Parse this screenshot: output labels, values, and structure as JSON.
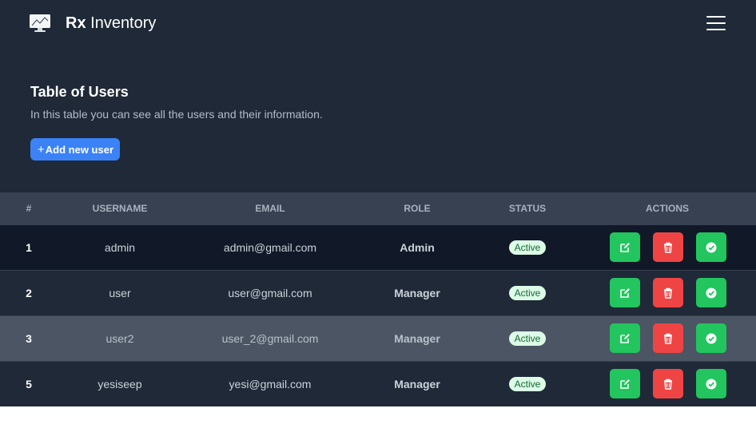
{
  "navbar": {
    "brand_bold": "Rx",
    "brand_rest": " Inventory",
    "logo_icon": "desktop-monitor-icon",
    "menu_icon": "hamburger-menu-icon"
  },
  "header": {
    "title": "Table of Users",
    "subtitle": "In this table you can see all the users and their information.",
    "add_button_icon": "+",
    "add_button_label": "Add new user"
  },
  "table": {
    "columns": [
      "#",
      "USERNAME",
      "EMAIL",
      "ROLE",
      "STATUS",
      "ACTIONS"
    ],
    "rows": [
      {
        "id": "1",
        "username": "admin",
        "email": "admin@gmail.com",
        "role": "Admin",
        "status": "Active"
      },
      {
        "id": "2",
        "username": "user",
        "email": "user@gmail.com",
        "role": "Manager",
        "status": "Active"
      },
      {
        "id": "3",
        "username": "user2",
        "email": "user_2@gmail.com",
        "role": "Manager",
        "status": "Active"
      },
      {
        "id": "5",
        "username": "yesiseep",
        "email": "yesi@gmail.com",
        "role": "Manager",
        "status": "Active"
      }
    ],
    "action_icons": [
      "edit-icon",
      "trash-icon",
      "check-circle-icon"
    ]
  },
  "colors": {
    "background": "#1f2937",
    "header_row": "#374151",
    "primary": "#3b82f6",
    "success": "#22c55e",
    "danger": "#ef4444",
    "badge_bg": "#dcfce7",
    "badge_text": "#166534"
  }
}
